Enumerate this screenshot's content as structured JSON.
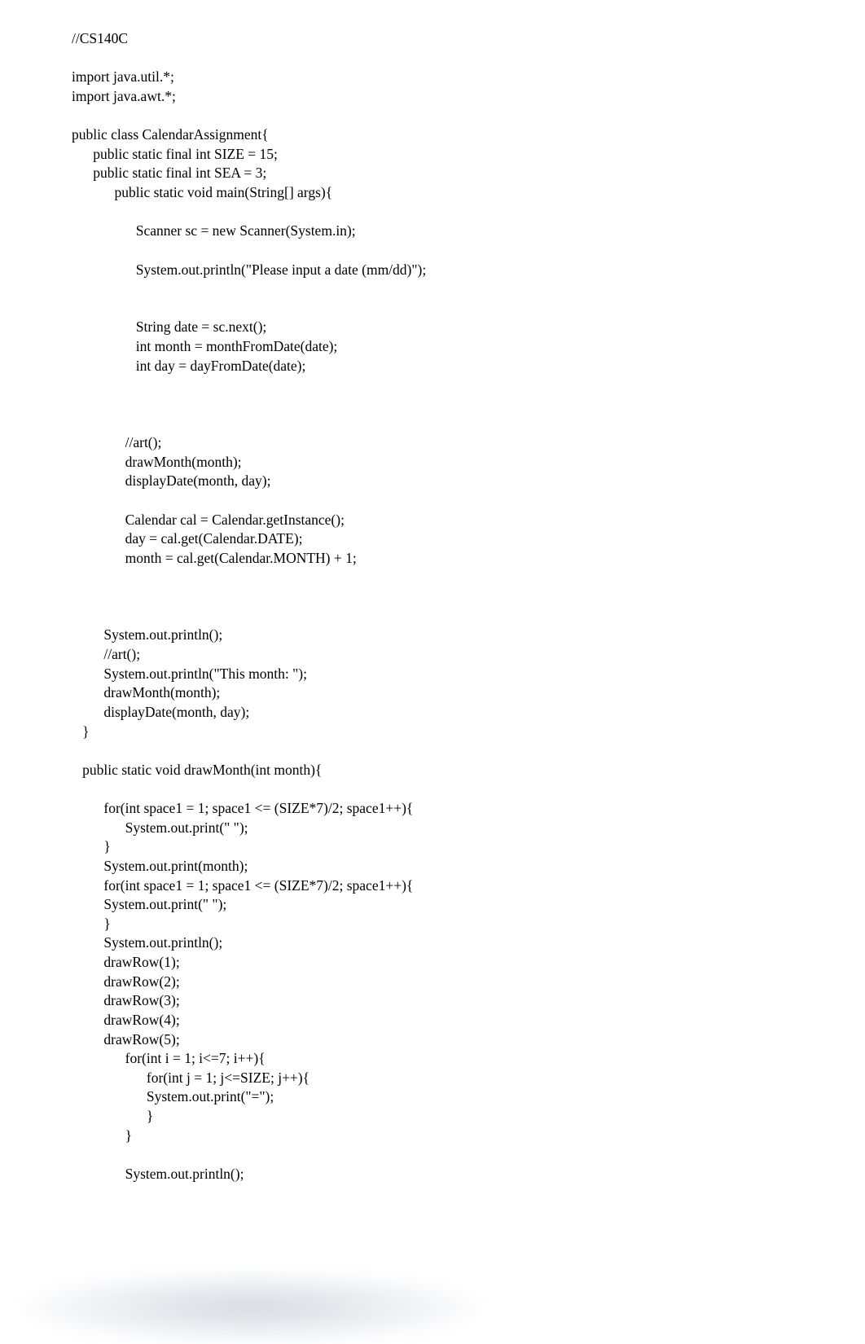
{
  "lines": [
    "//CS140C",
    "",
    "import java.util.*;",
    "import java.awt.*;",
    "",
    "public class CalendarAssignment{",
    "      public static final int SIZE = 15;",
    "      public static final int SEA = 3;",
    "            public static void main(String[] args){",
    "",
    "                  Scanner sc = new Scanner(System.in);",
    "",
    "                  System.out.println(\"Please input a date (mm/dd)\");",
    "",
    "",
    "                  String date = sc.next();",
    "                  int month = monthFromDate(date);",
    "                  int day = dayFromDate(date);",
    "",
    "",
    "",
    "               //art();",
    "               drawMonth(month);",
    "               displayDate(month, day);",
    "",
    "               Calendar cal = Calendar.getInstance();",
    "               day = cal.get(Calendar.DATE);",
    "               month = cal.get(Calendar.MONTH) + 1;",
    "",
    "",
    "",
    "         System.out.println();",
    "         //art();",
    "         System.out.println(\"This month: \");",
    "         drawMonth(month);",
    "         displayDate(month, day);",
    "   }",
    "",
    "   public static void drawMonth(int month){",
    "",
    "         for(int space1 = 1; space1 <= (SIZE*7)/2; space1++){",
    "               System.out.print(\" \");",
    "         }",
    "         System.out.print(month);",
    "         for(int space1 = 1; space1 <= (SIZE*7)/2; space1++){",
    "         System.out.print(\" \");",
    "         }",
    "         System.out.println();",
    "         drawRow(1);",
    "         drawRow(2);",
    "         drawRow(3);",
    "         drawRow(4);",
    "         drawRow(5);",
    "               for(int i = 1; i<=7; i++){",
    "                     for(int j = 1; j<=SIZE; j++){",
    "                     System.out.print(\"=\");",
    "                     }",
    "               }",
    "",
    "               System.out.println();"
  ]
}
